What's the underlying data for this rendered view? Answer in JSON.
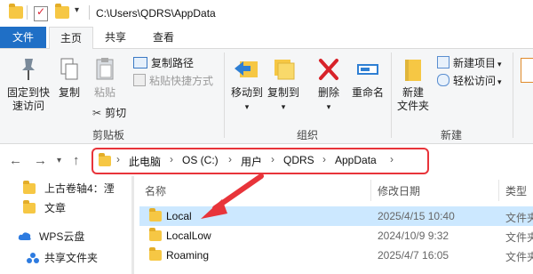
{
  "titlebar": {
    "path": "C:\\Users\\QDRS\\AppData"
  },
  "tabs": {
    "file": "文件",
    "home": "主页",
    "share": "共享",
    "view": "查看"
  },
  "ribbon": {
    "clipboard": {
      "pin_label_1": "固定到快",
      "pin_label_2": "速访问",
      "copy": "复制",
      "paste": "粘贴",
      "copy_path": "复制路径",
      "paste_shortcut": "粘贴快捷方式",
      "cut": "剪切",
      "group": "剪贴板"
    },
    "organize": {
      "move_to": "移动到",
      "copy_to": "复制到",
      "delete": "删除",
      "rename": "重命名",
      "group": "组织"
    },
    "new": {
      "new_folder_1": "新建",
      "new_folder_2": "文件夹",
      "new_item": "新建项目",
      "easy_access": "轻松访问",
      "group": "新建"
    }
  },
  "address": {
    "crumbs": [
      "此电脑",
      "OS (C:)",
      "用户",
      "QDRS",
      "AppData"
    ]
  },
  "navpane": {
    "items": [
      {
        "label": "上古卷轴4：湮",
        "icon": "folder-icon"
      },
      {
        "label": "文章",
        "icon": "folder-icon"
      },
      {
        "label": "WPS云盘",
        "icon": "cloud-icon"
      },
      {
        "label": "共享文件夹",
        "icon": "shared-icon"
      }
    ]
  },
  "filelist": {
    "headers": {
      "name": "名称",
      "date": "修改日期",
      "type": "类型"
    },
    "rows": [
      {
        "name": "Local",
        "date": "2025/4/15 10:40",
        "type": "文件夹"
      },
      {
        "name": "LocalLow",
        "date": "2024/10/9 9:32",
        "type": "文件夹"
      },
      {
        "name": "Roaming",
        "date": "2025/4/7 16:05",
        "type": "文件夹"
      }
    ]
  },
  "colors": {
    "accent": "#1f6fc6",
    "selection": "#cce8ff",
    "annotation": "#e8343a",
    "folder": "#f6c744"
  }
}
